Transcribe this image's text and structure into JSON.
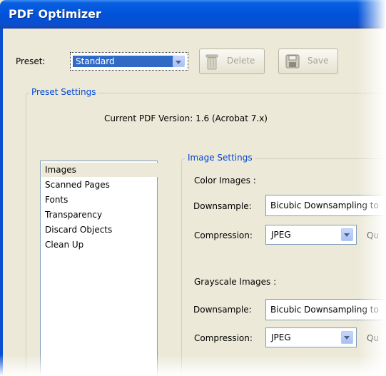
{
  "window": {
    "title": "PDF Optimizer"
  },
  "preset": {
    "label": "Preset:",
    "selected": "Standard",
    "delete_label": "Delete",
    "save_label": "Save"
  },
  "preset_settings": {
    "title": "Preset Settings",
    "version_text": "Current PDF Version: 1.6 (Acrobat 7.x)"
  },
  "categories": [
    "Images",
    "Scanned Pages",
    "Fonts",
    "Transparency",
    "Discard Objects",
    "Clean Up"
  ],
  "image_settings": {
    "title": "Image Settings",
    "color": {
      "heading": "Color Images :",
      "downsample_label": "Downsample:",
      "downsample_value": "Bicubic Downsampling to",
      "compression_label": "Compression:",
      "compression_value": "JPEG",
      "quality_label": "Qu"
    },
    "grayscale": {
      "heading": "Grayscale Images :",
      "downsample_label": "Downsample:",
      "downsample_value": "Bicubic Downsampling to",
      "compression_label": "Compression:",
      "compression_value": "JPEG",
      "quality_label": "Qu"
    }
  },
  "colors": {
    "titlebar": "#0052d9",
    "accent_text": "#0046d5",
    "window_bg": "#ece9d8"
  }
}
